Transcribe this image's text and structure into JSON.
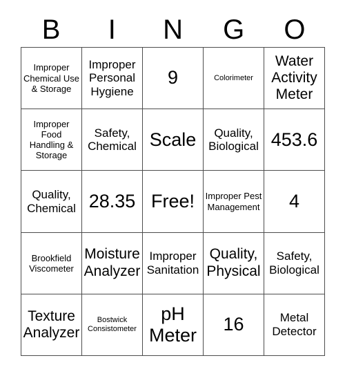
{
  "card": {
    "headers": [
      "B",
      "I",
      "N",
      "G",
      "O"
    ],
    "rows": [
      [
        {
          "text": "Improper Chemical Use & Storage",
          "size": "size-sm"
        },
        {
          "text": "Improper Personal Hygiene",
          "size": "size-md"
        },
        {
          "text": "9",
          "size": "size-xl"
        },
        {
          "text": "Colorimeter",
          "size": "size-xs"
        },
        {
          "text": "Water Activity Meter",
          "size": "size-lg"
        }
      ],
      [
        {
          "text": "Improper Food Handling & Storage",
          "size": "size-sm"
        },
        {
          "text": "Safety, Chemical",
          "size": "size-md"
        },
        {
          "text": "Scale",
          "size": "size-xl"
        },
        {
          "text": "Quality, Biological",
          "size": "size-md"
        },
        {
          "text": "453.6",
          "size": "size-xl"
        }
      ],
      [
        {
          "text": "Quality, Chemical",
          "size": "size-md"
        },
        {
          "text": "28.35",
          "size": "size-xl"
        },
        {
          "text": "Free!",
          "size": "size-xl"
        },
        {
          "text": "Improper Pest Management",
          "size": "size-sm"
        },
        {
          "text": "4",
          "size": "size-xl"
        }
      ],
      [
        {
          "text": "Brookfield Viscometer",
          "size": "size-sm"
        },
        {
          "text": "Moisture Analyzer",
          "size": "size-lg"
        },
        {
          "text": "Improper Sanitation",
          "size": "size-md"
        },
        {
          "text": "Quality, Physical",
          "size": "size-lg"
        },
        {
          "text": "Safety, Biological",
          "size": "size-md"
        }
      ],
      [
        {
          "text": "Texture Analyzer",
          "size": "size-lg"
        },
        {
          "text": "Bostwick Consistometer",
          "size": "size-xs"
        },
        {
          "text": "pH Meter",
          "size": "size-xl"
        },
        {
          "text": "16",
          "size": "size-xl"
        },
        {
          "text": "Metal Detector",
          "size": "size-md"
        }
      ]
    ]
  },
  "colors": {
    "border": "#4d4d4d",
    "text": "#000000",
    "background": "#ffffff"
  }
}
